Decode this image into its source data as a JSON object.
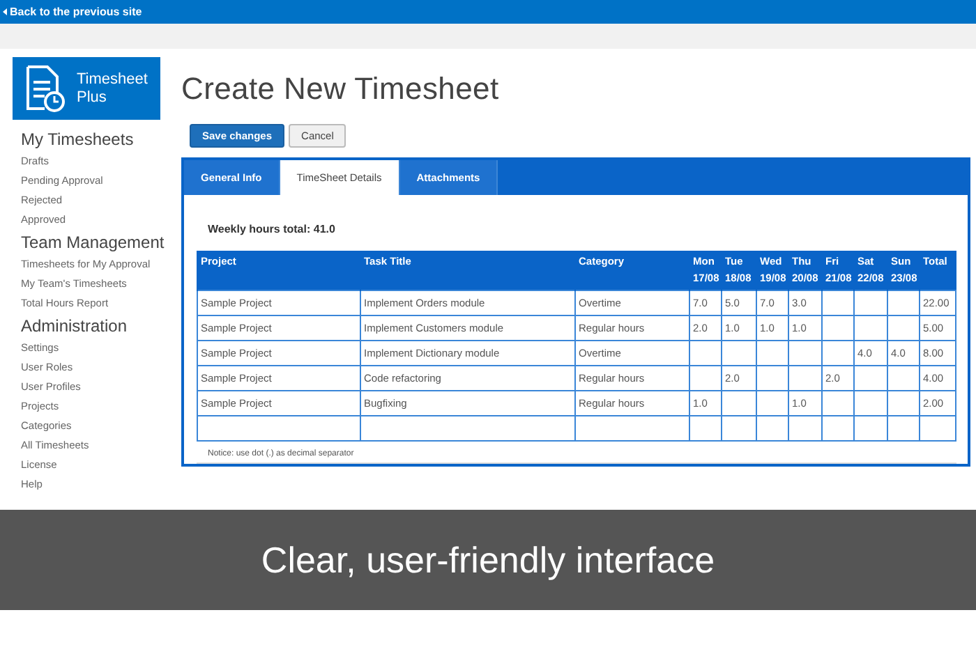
{
  "top_bar": {
    "back_link": "Back to the previous site"
  },
  "logo": {
    "text": "Timesheet Plus"
  },
  "sidebar": {
    "sections": [
      {
        "heading": "My Timesheets",
        "items": [
          "Drafts",
          "Pending Approval",
          "Rejected",
          "Approved"
        ]
      },
      {
        "heading": "Team Management",
        "items": [
          "Timesheets for My Approval",
          "My Team's Timesheets",
          "Total Hours Report"
        ]
      },
      {
        "heading": "Administration",
        "items": [
          "Settings",
          "User Roles",
          "User Profiles",
          "Projects",
          "Categories",
          "All Timesheets",
          "License",
          "Help"
        ]
      }
    ]
  },
  "page_title": "Create New Timesheet",
  "buttons": [
    {
      "label": "Save changes",
      "kind": "primary"
    },
    {
      "label": "Cancel",
      "kind": "secondary"
    }
  ],
  "tabs": [
    {
      "label": "General Info",
      "selected": false
    },
    {
      "label": "TimeSheet Details",
      "selected": true
    },
    {
      "label": "Attachments",
      "selected": false
    }
  ],
  "weekly_total": "Weekly hours total: 41.0",
  "table": {
    "columns": [
      {
        "label": "Project"
      },
      {
        "label": "Task Title"
      },
      {
        "label": "Category"
      },
      {
        "label": "Mon",
        "date": "17/08"
      },
      {
        "label": "Tue",
        "date": "18/08"
      },
      {
        "label": "Wed",
        "date": "19/08"
      },
      {
        "label": "Thu",
        "date": "20/08"
      },
      {
        "label": "Fri",
        "date": "21/08"
      },
      {
        "label": "Sat",
        "date": "22/08"
      },
      {
        "label": "Sun",
        "date": "23/08"
      },
      {
        "label": "Total"
      }
    ],
    "rows": [
      {
        "project": "Sample Project",
        "task": "Implement Orders module",
        "category": "Overtime",
        "hours": {
          "mon": "7.0",
          "tue": "5.0",
          "wed": "7.0",
          "thu": "3.0"
        },
        "total": "22.00"
      },
      {
        "project": "Sample Project",
        "task": "Implement Customers module",
        "category": "Regular hours",
        "hours": {
          "mon": "2.0",
          "tue": "1.0",
          "wed": "1.0",
          "thu": "1.0"
        },
        "total": "5.00"
      },
      {
        "project": "Sample Project",
        "task": "Implement Dictionary module",
        "category": "Overtime",
        "hours": {
          "sat": "4.0",
          "sun": "4.0"
        },
        "total": "8.00"
      },
      {
        "project": "Sample Project",
        "task": "Code refactoring",
        "category": "Regular hours",
        "hours": {
          "tue": "2.0",
          "fri": "2.0"
        },
        "total": "4.00"
      },
      {
        "project": "Sample Project",
        "task": "Bugfixing",
        "category": "Regular hours",
        "hours": {
          "mon": "1.0",
          "thu": "1.0"
        },
        "total": "2.00"
      }
    ]
  },
  "notice": "Notice: use dot (.) as decimal separator",
  "caption": "Clear, user-friendly interface"
}
